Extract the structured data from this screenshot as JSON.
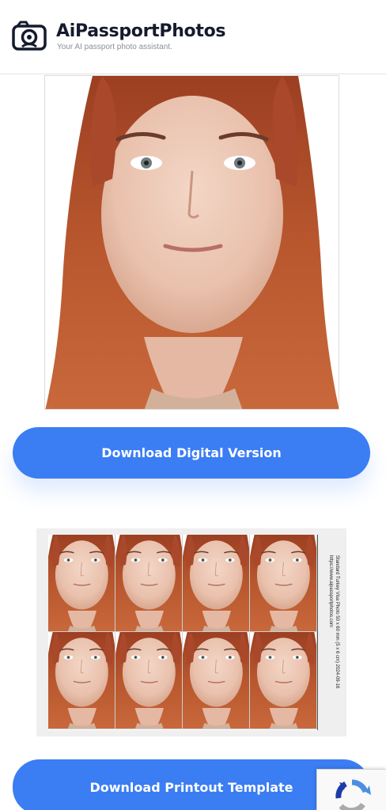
{
  "header": {
    "brand": "AiPassportPhotos",
    "tagline": "Your AI passport photo assistant.",
    "logo_icon": "camera-icon"
  },
  "main": {
    "photo_alt": "Passport photo preview",
    "download_digital_label": "Download Digital Version",
    "download_printout_label": "Download Printout Template"
  },
  "print_sheet": {
    "rows": 2,
    "columns": 4,
    "caption_line1": "Standard Turkey Visa Photo 50 x 60 mm (5 x 6 cm) 2024-09-16",
    "caption_line2": "https://www.aipassportphotos.com"
  },
  "colors": {
    "accent": "#3b7df2",
    "brand_text": "#151a2d",
    "hair": "#b5532c"
  },
  "widgets": {
    "recaptcha_icon": "recaptcha-icon"
  }
}
